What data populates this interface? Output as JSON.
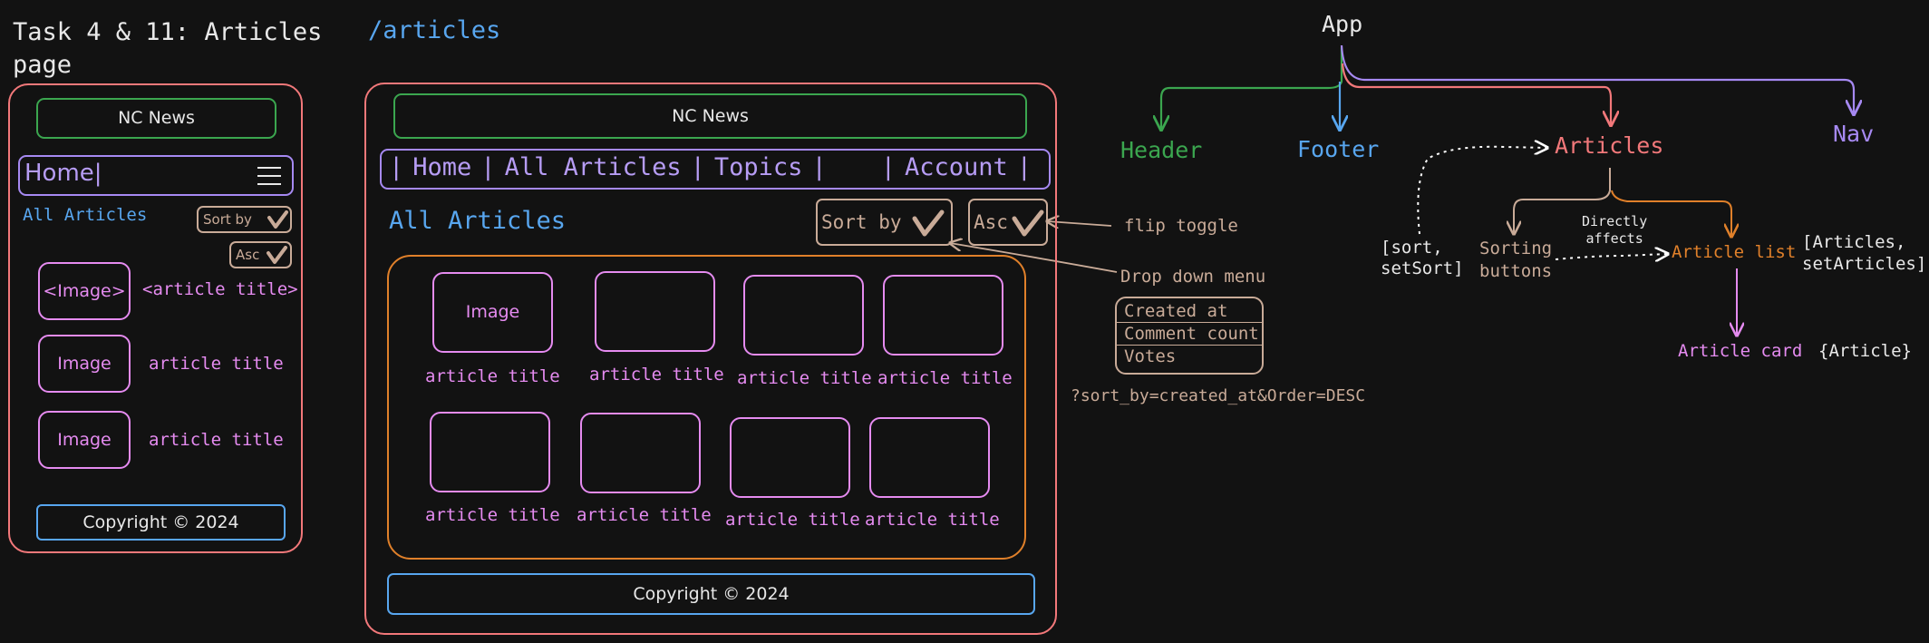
{
  "colors": {
    "bg": "#121212",
    "page_frame": "#f2787a",
    "header": "#3ba64f",
    "nav": "#a689f2",
    "footer": "#58a6ef",
    "articles": "#f2787a",
    "article_list": "#e0802a",
    "article_card": "#e58bf0",
    "sort": "#c9ab98"
  },
  "mobile": {
    "task_title_line1": "Task 4 & 11: Articles",
    "task_title_line2": "page",
    "header": "NC News",
    "nav_home": "Home|",
    "menu_icon": "hamburger-icon",
    "heading": "All Articles",
    "sort_by": "Sort by",
    "order": "Asc",
    "items": [
      {
        "image": "<Image>",
        "title": "<article title>"
      },
      {
        "image": "Image",
        "title": "article title"
      },
      {
        "image": "Image",
        "title": "article title"
      }
    ],
    "footer": "Copyright © 2024"
  },
  "desktop": {
    "route": "/articles",
    "header": "NC News",
    "nav": {
      "sep": "|",
      "home": "Home",
      "all_articles": "All Articles",
      "topics": "Topics",
      "account": "Account"
    },
    "heading": "All Articles",
    "sort_by": "Sort by",
    "order": "Asc",
    "cards": [
      {
        "image": "Image",
        "title": "article title"
      },
      {
        "image": "",
        "title": "article title"
      },
      {
        "image": "",
        "title": "article title"
      },
      {
        "image": "",
        "title": "article title"
      },
      {
        "image": "",
        "title": "article title"
      },
      {
        "image": "",
        "title": "article title"
      },
      {
        "image": "",
        "title": "article title"
      },
      {
        "image": "",
        "title": "article title"
      }
    ],
    "footer": "Copyright © 2024"
  },
  "annotations": {
    "flip_toggle": "flip toggle",
    "drop_down_menu": "Drop down menu",
    "dropdown_options": [
      "Created at",
      "Comment count",
      "Votes"
    ],
    "query": "?sort_by=created_at&Order=DESC"
  },
  "tree": {
    "app": "App",
    "header": "Header",
    "footer": "Footer",
    "articles": "Articles",
    "nav": "Nav",
    "sort_state_line1": "[sort,",
    "sort_state_line2": "setSort]",
    "sorting_buttons_line1": "Sorting",
    "sorting_buttons_line2": "buttons",
    "directly_affects_line1": "Directly",
    "directly_affects_line2": "affects",
    "article_list": "Article list",
    "articles_state_line1": "[Articles,",
    "articles_state_line2": "setArticles]",
    "article_card": "Article card",
    "article_prop": "{Article}"
  }
}
